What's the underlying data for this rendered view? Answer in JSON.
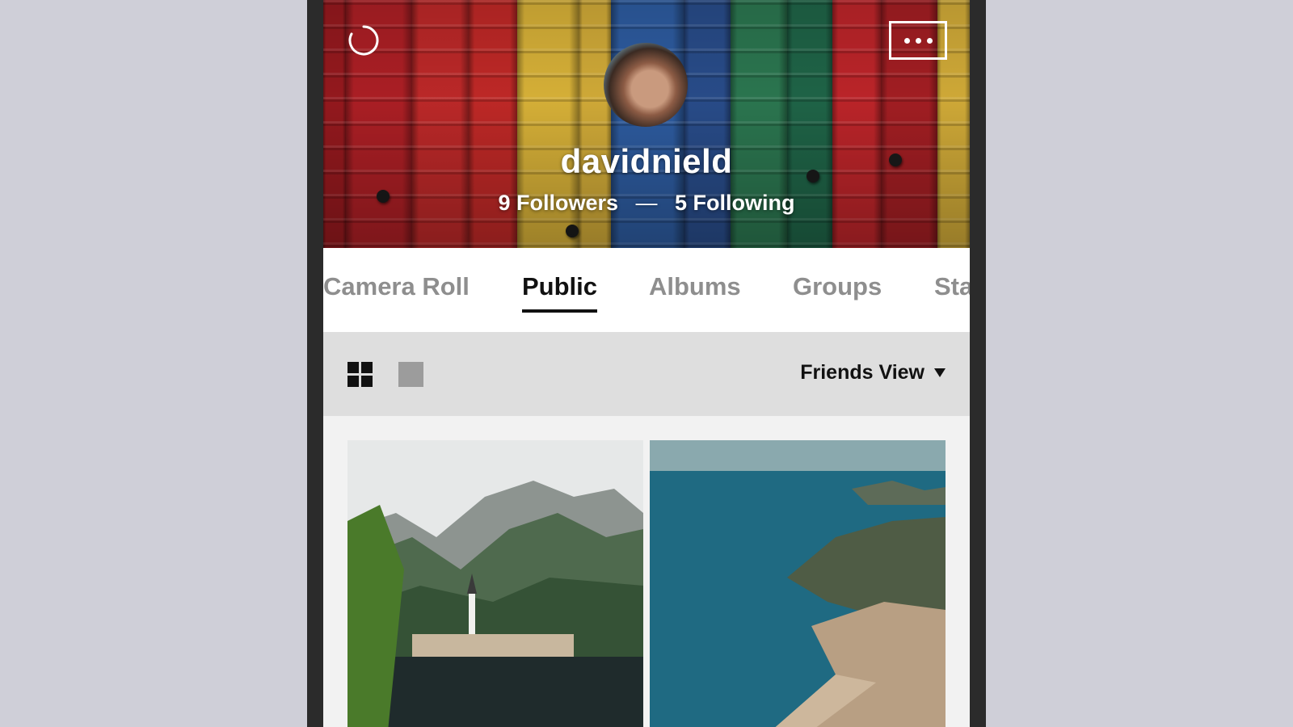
{
  "profile": {
    "username": "davidnield",
    "followers": "9 Followers",
    "separator": "—",
    "following": "5 Following"
  },
  "header": {
    "loading_icon": "loading-spinner-icon",
    "more_icon": "more-dots-icon"
  },
  "tabs": [
    {
      "label": "Camera Roll",
      "active": false
    },
    {
      "label": "Public",
      "active": true
    },
    {
      "label": "Albums",
      "active": false
    },
    {
      "label": "Groups",
      "active": false
    },
    {
      "label": "Sta",
      "active": false
    }
  ],
  "toolbar": {
    "grid_view_icon": "grid-view-icon",
    "single_view_icon": "single-view-icon",
    "view_select": "Friends View"
  },
  "photos": [
    {
      "subject": "mountain lake village"
    },
    {
      "subject": "coastline aerial"
    }
  ],
  "colors": {
    "active_tab": "#111111",
    "inactive_tab": "#8e8e8e",
    "toolbar_bg": "#dedede"
  }
}
